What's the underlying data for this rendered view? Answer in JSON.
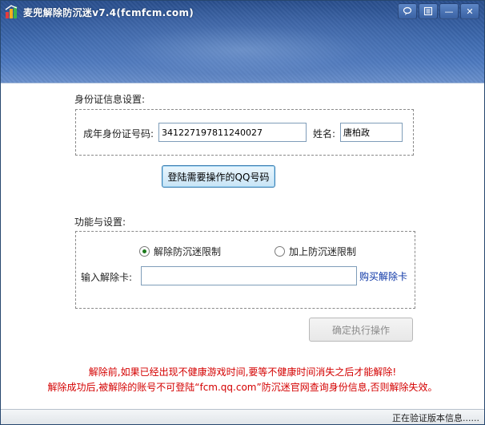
{
  "window": {
    "title": "麦兜解除防沉迷v7.4(fcmfcm.com)",
    "icon": "app-logo-icon",
    "controls": [
      {
        "name": "feedback-icon"
      },
      {
        "name": "menu-icon"
      },
      {
        "name": "minimize-icon",
        "glyph": "—"
      },
      {
        "name": "close-icon",
        "glyph": "✕"
      }
    ],
    "accent_color": "#3c68ad"
  },
  "id_section": {
    "title": "身份证信息设置:",
    "id_label": "成年身份证号码:",
    "id_value": "341227197811240027",
    "name_label": "姓名:",
    "name_value": "唐柏政"
  },
  "login_button": {
    "label": "登陆需要操作的QQ号码"
  },
  "func_section": {
    "title": "功能与设置:",
    "radio_remove": "解除防沉迷限制",
    "radio_add": "加上防沉迷限制",
    "selected": "remove",
    "card_label": "输入解除卡:",
    "card_value": "",
    "buy_link": "购买解除卡"
  },
  "execute_button": {
    "label": "确定执行操作"
  },
  "warnings": {
    "line1": "解除前,如果已经出现不健康游戏时间,要等不健康时间消失之后才能解除!",
    "line2": "解除成功后,被解除的账号不可登陆“fcm.qq.com”防沉迷官网查询身份信息,否则解除失效。",
    "color": "#d40000"
  },
  "status_bar": {
    "text": "正在验证版本信息......"
  }
}
